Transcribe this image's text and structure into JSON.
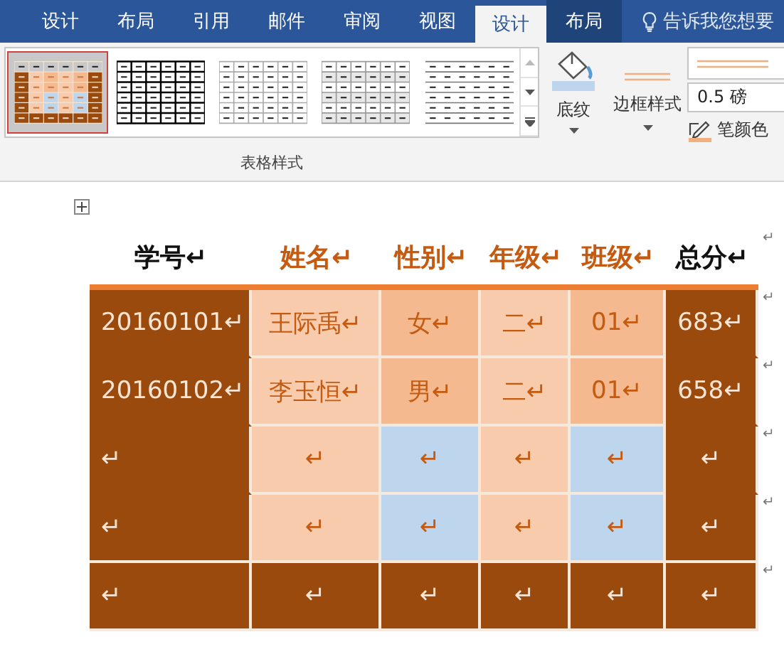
{
  "ribbon": {
    "tabs": [
      {
        "label": "设计",
        "selected": false,
        "contextual": false
      },
      {
        "label": "布局",
        "selected": false,
        "contextual": false
      },
      {
        "label": "引用",
        "selected": false,
        "contextual": false
      },
      {
        "label": "邮件",
        "selected": false,
        "contextual": false
      },
      {
        "label": "审阅",
        "selected": false,
        "contextual": false
      },
      {
        "label": "视图",
        "selected": false,
        "contextual": false
      },
      {
        "label": "设计",
        "selected": true,
        "contextual": true
      },
      {
        "label": "布局",
        "selected": false,
        "contextual": true
      }
    ],
    "tell_me": "告诉我您想要",
    "gallery": {
      "styles": [
        {
          "kind": "colorful",
          "selected": true
        },
        {
          "kind": "grid",
          "selected": false
        },
        {
          "kind": "plain",
          "selected": false
        },
        {
          "kind": "banded",
          "selected": false
        },
        {
          "kind": "lines",
          "selected": false
        }
      ],
      "label": "表格样式"
    },
    "shading_button": "底纹",
    "border_styles_button": "边框样式",
    "line_weight": "0.5 磅",
    "pen_color_button": "笔颜色"
  },
  "table": {
    "header": [
      {
        "text": "学号↵",
        "highlighted": false
      },
      {
        "text": "姓名↵",
        "highlighted": true
      },
      {
        "text": "性别↵",
        "highlighted": true
      },
      {
        "text": "年级↵",
        "highlighted": true
      },
      {
        "text": "班级↵",
        "highlighted": true
      },
      {
        "text": "总分↵",
        "highlighted": false
      }
    ],
    "header_end_mark": "↵",
    "rows": [
      {
        "end_mark": "↵",
        "cells": [
          {
            "text": "20160101↵",
            "color": "#9a4a0c"
          },
          {
            "text": "王际禹↵",
            "color": "#f7cbac"
          },
          {
            "text": "女↵",
            "color": "#f4b98f"
          },
          {
            "text": "二↵",
            "color": "#f7cbac"
          },
          {
            "text": "01↵",
            "color": "#f4b98f"
          },
          {
            "text": "683↵",
            "color": "#9a4a0c"
          }
        ]
      },
      {
        "end_mark": "↵",
        "cells": [
          {
            "text": "20160102↵",
            "color": "#9a4a0c"
          },
          {
            "text": "李玉恒↵",
            "color": "#f7cbac"
          },
          {
            "text": "男↵",
            "color": "#f4b98f"
          },
          {
            "text": "二↵",
            "color": "#f7cbac"
          },
          {
            "text": "01↵",
            "color": "#f4b98f"
          },
          {
            "text": "658↵",
            "color": "#9a4a0c"
          }
        ]
      },
      {
        "end_mark": "↵",
        "cells": [
          {
            "text": "↵",
            "color": "#9a4a0c"
          },
          {
            "text": "↵",
            "color": "#f7cbac"
          },
          {
            "text": "↵",
            "color": "#bdd6ee"
          },
          {
            "text": "↵",
            "color": "#f7cbac"
          },
          {
            "text": "↵",
            "color": "#bdd6ee"
          },
          {
            "text": "↵",
            "color": "#9a4a0c"
          }
        ]
      },
      {
        "end_mark": "↵",
        "cells": [
          {
            "text": "↵",
            "color": "#9a4a0c"
          },
          {
            "text": "↵",
            "color": "#f7cbac"
          },
          {
            "text": "↵",
            "color": "#bdd6ee"
          },
          {
            "text": "↵",
            "color": "#f7cbac"
          },
          {
            "text": "↵",
            "color": "#bdd6ee"
          },
          {
            "text": "↵",
            "color": "#9a4a0c"
          }
        ]
      },
      {
        "end_mark": "↵",
        "cells": [
          {
            "text": "↵",
            "color": "#9a4a0c"
          },
          {
            "text": "↵",
            "color": "#9a4a0c"
          },
          {
            "text": "↵",
            "color": "#9a4a0c"
          },
          {
            "text": "↵",
            "color": "#9a4a0c"
          },
          {
            "text": "↵",
            "color": "#9a4a0c"
          },
          {
            "text": "↵",
            "color": "#9a4a0c"
          }
        ]
      }
    ]
  }
}
